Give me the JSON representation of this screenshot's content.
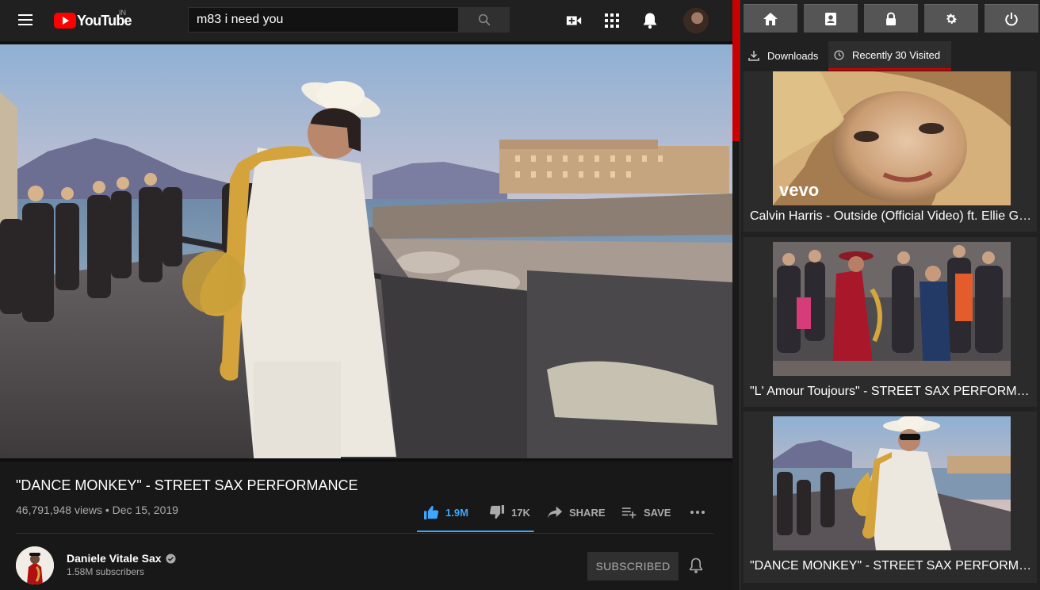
{
  "masthead": {
    "logo_text": "YouTube",
    "country_code": "IN",
    "search_value": "m83 i need you",
    "icons": [
      "menu-icon",
      "youtube-logo",
      "search-icon",
      "create-video-icon",
      "apps-grid-icon",
      "notifications-bell-icon",
      "account-avatar"
    ]
  },
  "video": {
    "title": "\"DANCE MONKEY\" - STREET SAX PERFORMANCE",
    "meta": "46,791,948 views • Dec 15, 2019",
    "likes": "1.9M",
    "dislikes": "17K",
    "like_ratio": 0.99,
    "share_label": "SHARE",
    "save_label": "SAVE"
  },
  "channel": {
    "name": "Daniele Vitale Sax",
    "subscribers": "1.58M subscribers",
    "subscribe_label": "SUBSCRIBED"
  },
  "panel": {
    "toolbar_icons": [
      "home-icon",
      "contact-card-icon",
      "lock-icon",
      "settings-gear-icon",
      "power-icon"
    ],
    "tabs": [
      {
        "label": "Downloads",
        "icon": "download-icon",
        "active": false
      },
      {
        "label": "Recently 30 Visited",
        "icon": "clock-icon",
        "active": true
      }
    ],
    "cards": [
      {
        "title": "Calvin Harris - Outside (Official Video) ft. Ellie Goulding",
        "badge": "vevo"
      },
      {
        "title": "\"L' Amour Toujours\" - STREET SAX PERFORMANCE",
        "badge": ""
      },
      {
        "title": "\"DANCE MONKEY\" - STREET SAX PERFORMANCE",
        "badge": ""
      }
    ]
  },
  "colors": {
    "accent_red": "#cc0000",
    "youtube_red": "#ff0000",
    "like_blue": "#3ea6ff",
    "background": "#181818",
    "panel_background": "#212121"
  }
}
